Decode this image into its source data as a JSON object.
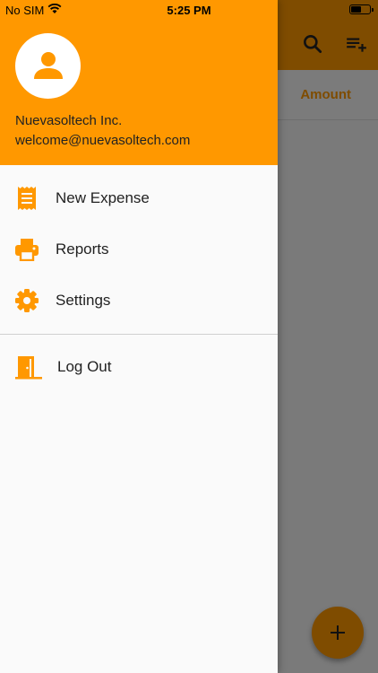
{
  "status_bar": {
    "carrier": "No SIM",
    "time": "5:25 PM"
  },
  "background": {
    "amount_header": "Amount",
    "icons": [
      "search-icon",
      "playlist-add-icon",
      "add-icon"
    ]
  },
  "drawer": {
    "company": "Nuevasoltech Inc.",
    "email": "welcome@nuevasoltech.com",
    "items": [
      {
        "label": "New Expense",
        "icon": "receipt-icon"
      },
      {
        "label": "Reports",
        "icon": "printer-icon"
      },
      {
        "label": "Settings",
        "icon": "gear-icon"
      },
      {
        "label": "Log Out",
        "icon": "exit-door-icon"
      }
    ]
  },
  "colors": {
    "accent": "#ff9800",
    "text": "#222222",
    "drawer_bg": "#fafafa"
  }
}
